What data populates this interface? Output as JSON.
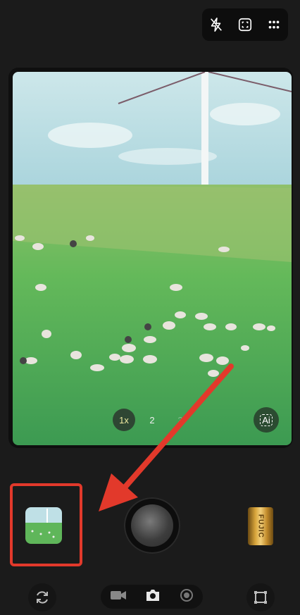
{
  "top_controls": {
    "icons": [
      "flash-off-icon",
      "frame-mode-icon",
      "more-dots-icon"
    ]
  },
  "viewfinder": {
    "zoom_levels": [
      "1x",
      "2",
      "3"
    ],
    "active_zoom": "1x",
    "ai_label": "Ai"
  },
  "gallery": {
    "thumbnail": "last-photo-thumbnail"
  },
  "film": {
    "label": "FUJIC"
  },
  "bottom_bar": {
    "modes": [
      "video-mode-icon",
      "photo-mode-icon",
      "live-mode-icon"
    ],
    "active_mode": "photo",
    "left_icon": "switch-camera-icon",
    "right_icon": "crop-frame-icon"
  },
  "annotation": {
    "arrow_color": "#e2392b",
    "highlight_color": "#e2392b"
  }
}
